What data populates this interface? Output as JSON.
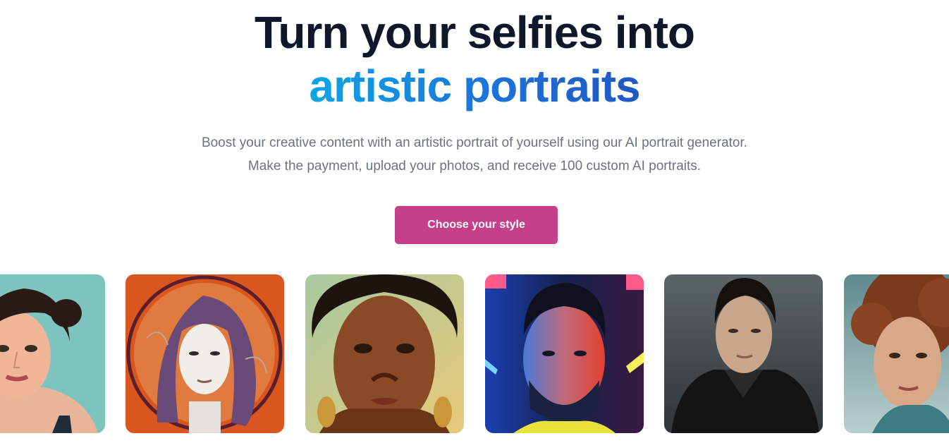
{
  "hero": {
    "title_line1": "Turn your selfies into",
    "title_line2": "artistic portraits",
    "subtitle_line1": "Boost your creative content with an artistic portrait of yourself using our AI portrait generator.",
    "subtitle_line2": "Make the payment, upload your photos, and receive 100 custom AI portraits.",
    "cta_label": "Choose your style"
  },
  "colors": {
    "title": "#0f172a",
    "accent_gradient_start": "#0ea5e9",
    "accent_gradient_end": "#2257c4",
    "cta_background": "#c4408a",
    "subtitle": "#6b7280"
  },
  "gallery": {
    "portraits": [
      {
        "style": "pop-art illustration"
      },
      {
        "style": "sketch on orange"
      },
      {
        "style": "realistic painting"
      },
      {
        "style": "neon lights"
      },
      {
        "style": "cinematic photo"
      },
      {
        "style": "soft light photo"
      }
    ]
  }
}
